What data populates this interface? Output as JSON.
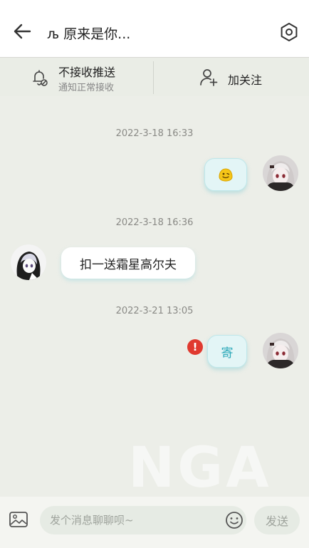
{
  "header": {
    "title": "љ 原来是你...",
    "back_icon": "arrow-left-icon",
    "settings_icon": "hexagon-settings-icon"
  },
  "action_bar": {
    "push_title": "不接收推送",
    "push_subtitle": "通知正常接收",
    "follow_label": "加关注",
    "bell_icon": "bell-off-icon",
    "follow_icon": "add-user-icon"
  },
  "messages": [
    {
      "timestamp": "2022-3-18 16:33",
      "direction": "outgoing",
      "content": "😊",
      "kind": "emoji"
    },
    {
      "timestamp": "2022-3-18 16:36",
      "direction": "incoming",
      "content": "扣一送霜星高尔夫",
      "kind": "text"
    },
    {
      "timestamp": "2022-3-21 13:05",
      "direction": "outgoing",
      "content": "寄",
      "kind": "text",
      "send_failed": true,
      "error_mark": "!"
    }
  ],
  "watermark": "NGA",
  "input_bar": {
    "placeholder": "发个消息聊聊呗~",
    "send_label": "发送",
    "image_icon": "image-icon",
    "emoji_icon": "emoji-icon"
  },
  "colors": {
    "background": "#eceee8",
    "accent": "#2aa8b8",
    "error": "#e0392f"
  }
}
